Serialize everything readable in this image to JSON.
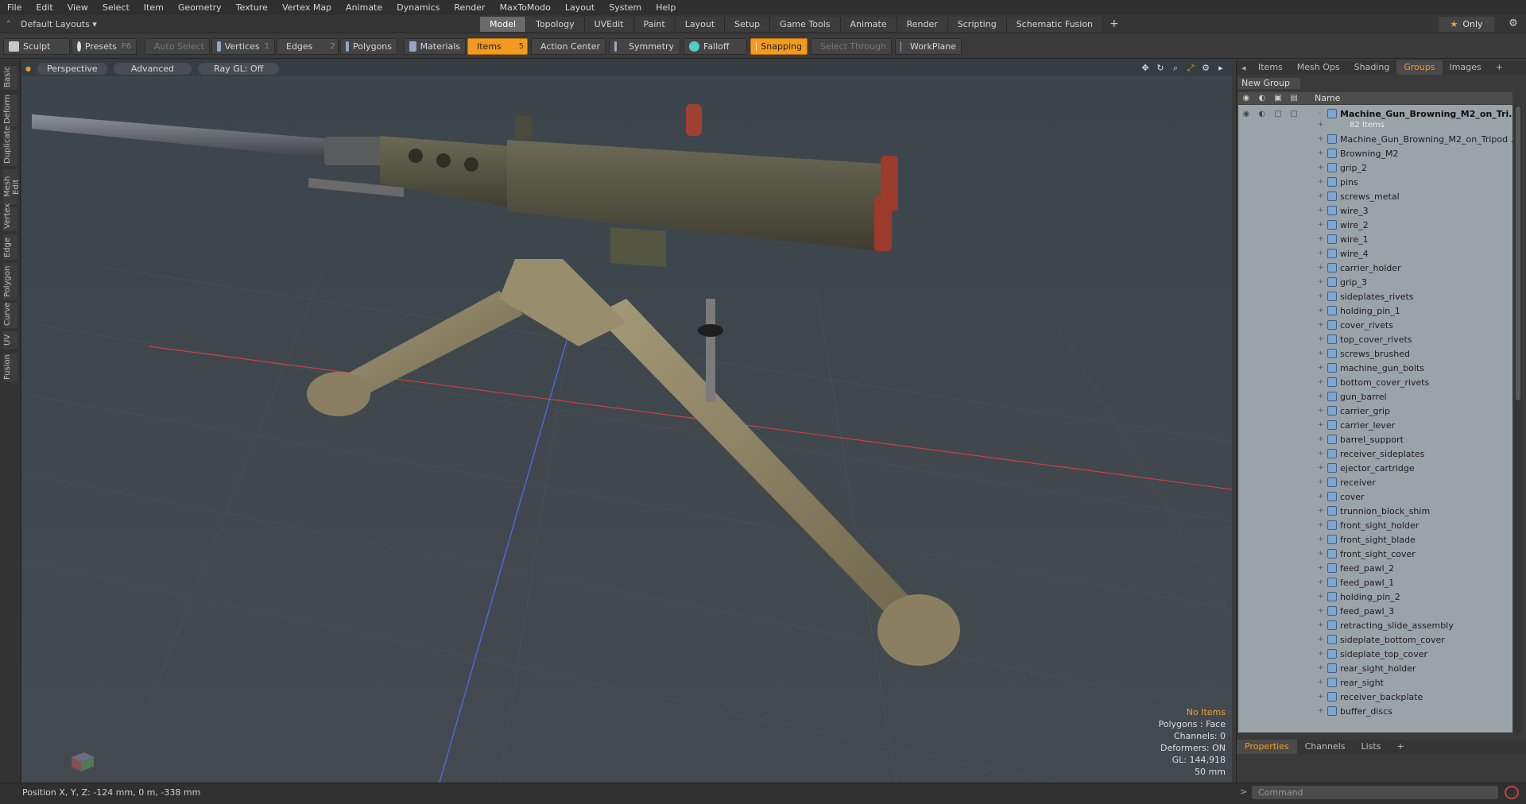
{
  "menu": [
    "File",
    "Edit",
    "View",
    "Select",
    "Item",
    "Geometry",
    "Texture",
    "Vertex Map",
    "Animate",
    "Dynamics",
    "Render",
    "MaxToModo",
    "Layout",
    "System",
    "Help"
  ],
  "layout": {
    "label": "Default Layouts ▾"
  },
  "tabs": [
    "Model",
    "Topology",
    "UVEdit",
    "Paint",
    "Layout",
    "Setup",
    "Game Tools",
    "Animate",
    "Render",
    "Scripting",
    "Schematic Fusion"
  ],
  "active_tab": "Model",
  "only_label": "Only",
  "toolbar": {
    "sculpt": "Sculpt",
    "presets": "Presets",
    "presets_key": "F6",
    "auto_select": "Auto Select",
    "vertices": "Vertices",
    "vertices_key": "1",
    "edges": "Edges",
    "edges_key": "2",
    "polygons": "Polygons",
    "materials": "Materials",
    "items": "Items",
    "items_key": "5",
    "action_center": "Action Center",
    "symmetry": "Symmetry",
    "falloff": "Falloff",
    "snapping": "Snapping",
    "select_through": "Select Through",
    "workplane": "WorkPlane"
  },
  "left_tabs": [
    "Basic",
    "Deform",
    "Duplicate",
    "Mesh Edit",
    "Vertex",
    "Edge",
    "Polygon",
    "Curve",
    "UV",
    "Fusion"
  ],
  "viewport": {
    "view": "Perspective",
    "shading": "Advanced",
    "raygl": "Ray GL: Off",
    "hud": {
      "items": "No Items",
      "polygons": "Polygons : Face",
      "channels": "Channels: 0",
      "deformers": "Deformers: ON",
      "gl": "GL: 144,918",
      "scale": "50 mm"
    }
  },
  "right_panel": {
    "tabs": [
      "Items",
      "Mesh Ops",
      "Shading",
      "Groups",
      "Images"
    ],
    "active_tab": "Groups",
    "new_group": "New Group",
    "name_header": "Name",
    "root": "Machine_Gun_Browning_M2_on_Tri...",
    "root_count": "82 Items",
    "items": [
      "Machine_Gun_Browning_M2_on_Tripod ...",
      "Browning_M2",
      "grip_2",
      "pins",
      "screws_metal",
      "wire_3",
      "wire_2",
      "wire_1",
      "wire_4",
      "carrier_holder",
      "grip_3",
      "sideplates_rivets",
      "holding_pin_1",
      "cover_rivets",
      "top_cover_rivets",
      "screws_brushed",
      "machine_gun_bolts",
      "bottom_cover_rivets",
      "gun_barrel",
      "carrier_grip",
      "carrier_lever",
      "barrel_support",
      "receiver_sideplates",
      "ejector_cartridge",
      "receiver",
      "cover",
      "trunnion_block_shim",
      "front_sight_holder",
      "front_sight_blade",
      "front_sight_cover",
      "feed_pawl_2",
      "feed_pawl_1",
      "holding_pin_2",
      "feed_pawl_3",
      "retracting_slide_assembly",
      "sideplate_bottom_cover",
      "sideplate_top_cover",
      "rear_sight_holder",
      "rear_sight",
      "receiver_backplate",
      "buffer_discs"
    ],
    "bottom_tabs": [
      "Properties",
      "Channels",
      "Lists"
    ],
    "bottom_active": "Properties"
  },
  "status": {
    "position": "Position X, Y, Z:   -124 mm, 0 m, -338 mm"
  },
  "command": {
    "placeholder": "Command"
  },
  "colors": {
    "accent": "#f29a1e",
    "viewport_bg": "#3f474d",
    "list_bg": "#9aa3a8"
  }
}
